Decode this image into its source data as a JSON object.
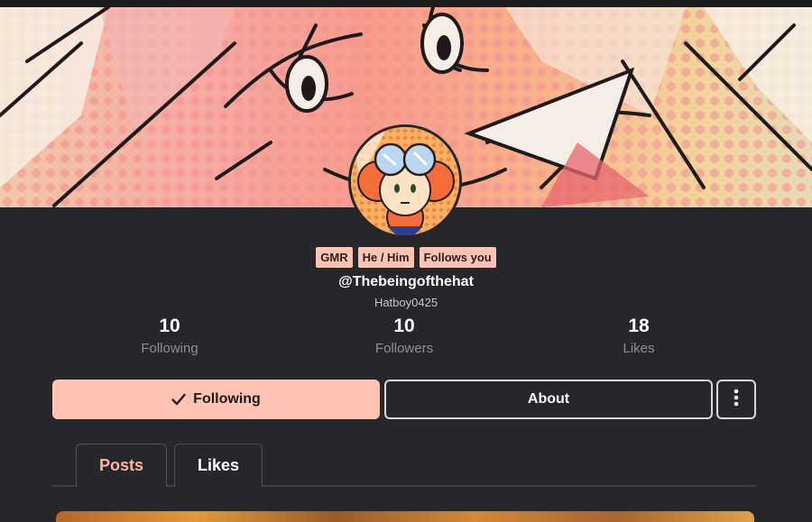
{
  "profile": {
    "handle": "@Thebeingofthehat",
    "username": "Hatboy0425",
    "badges": [
      "GMR",
      "He / Him",
      "Follows you"
    ]
  },
  "stats": [
    {
      "value": "10",
      "label": "Following"
    },
    {
      "value": "10",
      "label": "Followers"
    },
    {
      "value": "18",
      "label": "Likes"
    }
  ],
  "actions": {
    "following_label": "Following",
    "about_label": "About",
    "more_icon": "vertical-dots-icon",
    "check_icon": "checkmark-icon"
  },
  "tabs": [
    {
      "label": "Posts",
      "active": true
    },
    {
      "label": "Likes",
      "active": false
    }
  ],
  "colors": {
    "accent": "#ffc3b3",
    "background": "#25272a",
    "active_tab": "#ffb39e"
  }
}
